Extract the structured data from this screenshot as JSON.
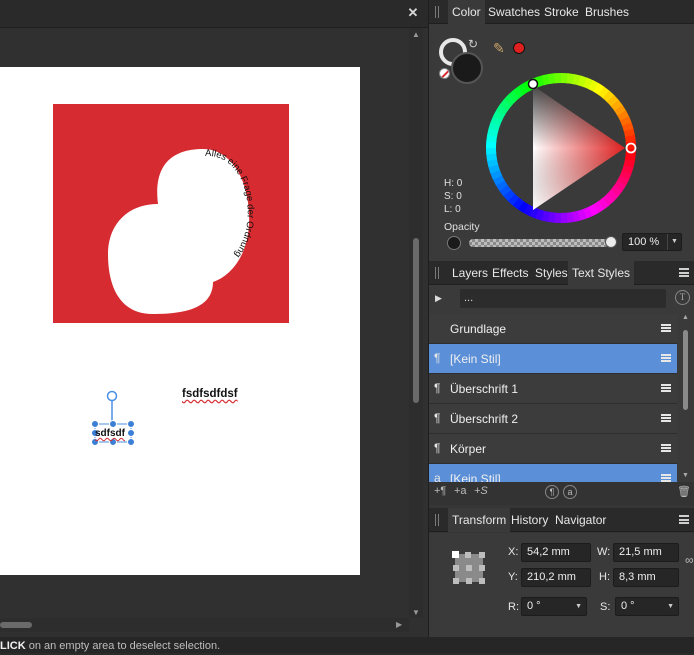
{
  "canvas": {
    "close_glyph": "✕",
    "doc_text_1": "fsdfsdfdsf",
    "doc_text_2": "sdfsdf",
    "path_text": "Alles eine Frage der Ordnung"
  },
  "color_panel": {
    "tabs": [
      "Color",
      "Swatches",
      "Stroke",
      "Brushes"
    ],
    "active_tab": "Color",
    "hsl": {
      "h": "H: 0",
      "s": "S: 0",
      "l": "L: 0"
    },
    "opacity_label": "Opacity",
    "opacity_value": "100 %",
    "opacity_fraction": 1.0,
    "hue_marker_color": "#e0201f",
    "fill_color": "#1a1a1a"
  },
  "layers_panel": {
    "tabs": [
      "Layers",
      "Effects",
      "Styles",
      "Text Styles"
    ],
    "active_tab": "Text Styles",
    "search_value": "...",
    "search_icon": "T",
    "items": [
      {
        "icon": "",
        "label": "Grundlage",
        "selected": false
      },
      {
        "icon": "¶",
        "label": "[Kein Stil]",
        "selected": true
      },
      {
        "icon": "¶",
        "label": "Überschrift 1",
        "selected": false
      },
      {
        "icon": "¶",
        "label": "Überschrift 2",
        "selected": false
      },
      {
        "icon": "¶",
        "label": "Körper",
        "selected": false
      },
      {
        "icon": "a",
        "label": "[Kein Stil]",
        "selected": true
      }
    ],
    "bottom_icons": [
      "+¶",
      "+a",
      "+S",
      "¶",
      "a",
      "🗑"
    ]
  },
  "transform_panel": {
    "tabs": [
      "Transform",
      "History",
      "Navigator"
    ],
    "active_tab": "Transform",
    "x_label": "X:",
    "x_value": "54,2 mm",
    "y_label": "Y:",
    "y_value": "210,2 mm",
    "w_label": "W:",
    "w_value": "21,5 mm",
    "h_label": "H:",
    "h_value": "8,3 mm",
    "r_label": "R:",
    "r_value": "0 °",
    "s_label": "S:",
    "s_value": "0 °"
  },
  "status_bar": {
    "bold": "LICK",
    "text": " on an empty area to deselect selection."
  }
}
